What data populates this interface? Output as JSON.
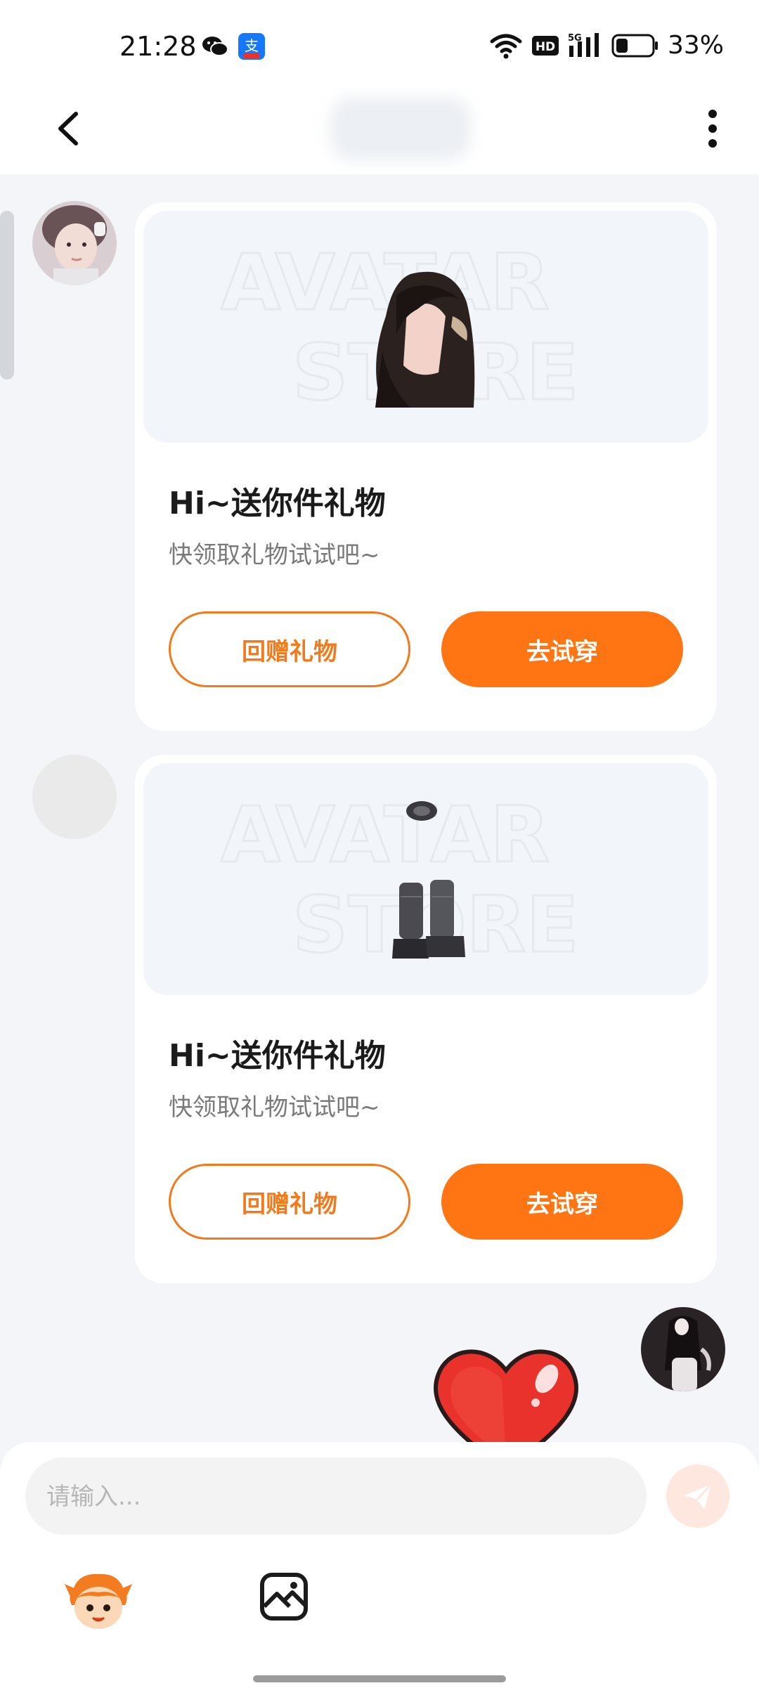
{
  "status_bar": {
    "time": "21:28",
    "battery_percent": "33%",
    "battery_level": 0.33,
    "network": "5G",
    "hd_label": "HD",
    "icons": [
      "wechat-icon",
      "alipay-icon",
      "wifi-icon",
      "hd-icon",
      "signal-5g-icon",
      "battery-icon"
    ]
  },
  "nav": {
    "icons": [
      "back-arrow-icon",
      "more-vertical-icon"
    ]
  },
  "messages": [
    {
      "watermark": [
        "AVATAR",
        "STORE"
      ],
      "title": "Hi~送你件礼物",
      "subtitle": "快领取礼物试试吧~",
      "secondary_button": "回赠礼物",
      "primary_button": "去试穿"
    },
    {
      "watermark": [
        "AVATAR",
        "STORE"
      ],
      "title": "Hi~送你件礼物",
      "subtitle": "快领取礼物试试吧~",
      "secondary_button": "回赠礼物",
      "primary_button": "去试穿"
    }
  ],
  "input": {
    "placeholder": "请输入..."
  },
  "toolbar_icons": [
    "emoji-mascot-icon",
    "image-icon"
  ],
  "colors": {
    "accent": "#ff7514",
    "accent_outline": "#f27a1a",
    "background": "#f3f5f8",
    "card": "#ffffff"
  }
}
